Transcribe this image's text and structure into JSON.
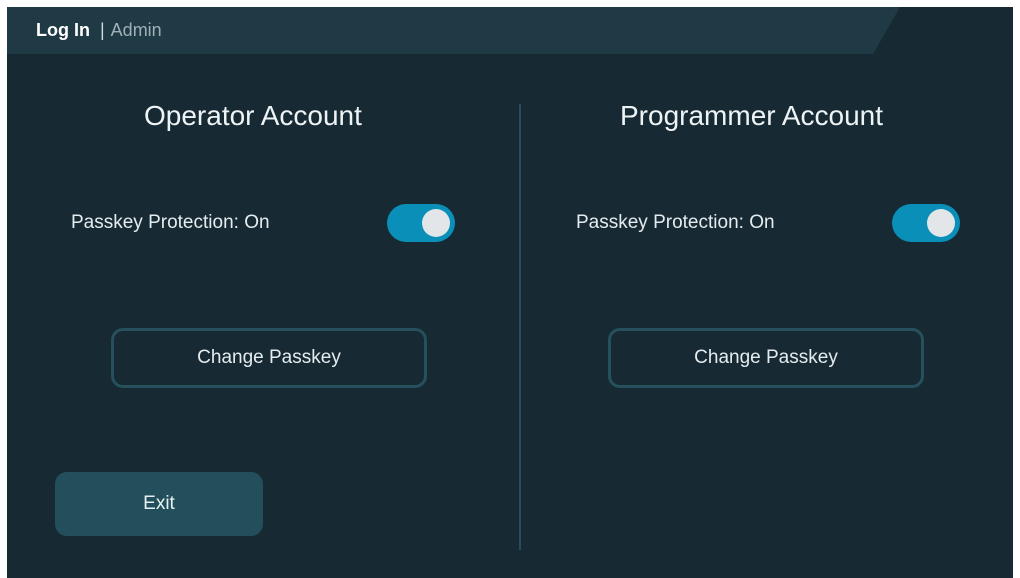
{
  "header": {
    "title": "Log In",
    "separator": "|",
    "subtitle": "Admin"
  },
  "operator": {
    "title": "Operator Account",
    "passkey_label": "Passkey Protection: On",
    "passkey_enabled": true,
    "change_label": "Change Passkey"
  },
  "programmer": {
    "title": "Programmer Account",
    "passkey_label": "Passkey Protection: On",
    "passkey_enabled": true,
    "change_label": "Change Passkey"
  },
  "footer": {
    "exit_label": "Exit"
  },
  "colors": {
    "background": "#172a33",
    "header": "#1f3a44",
    "toggle_on": "#0a8fb8",
    "button_fill": "#234f5c",
    "button_border": "#26505c"
  }
}
